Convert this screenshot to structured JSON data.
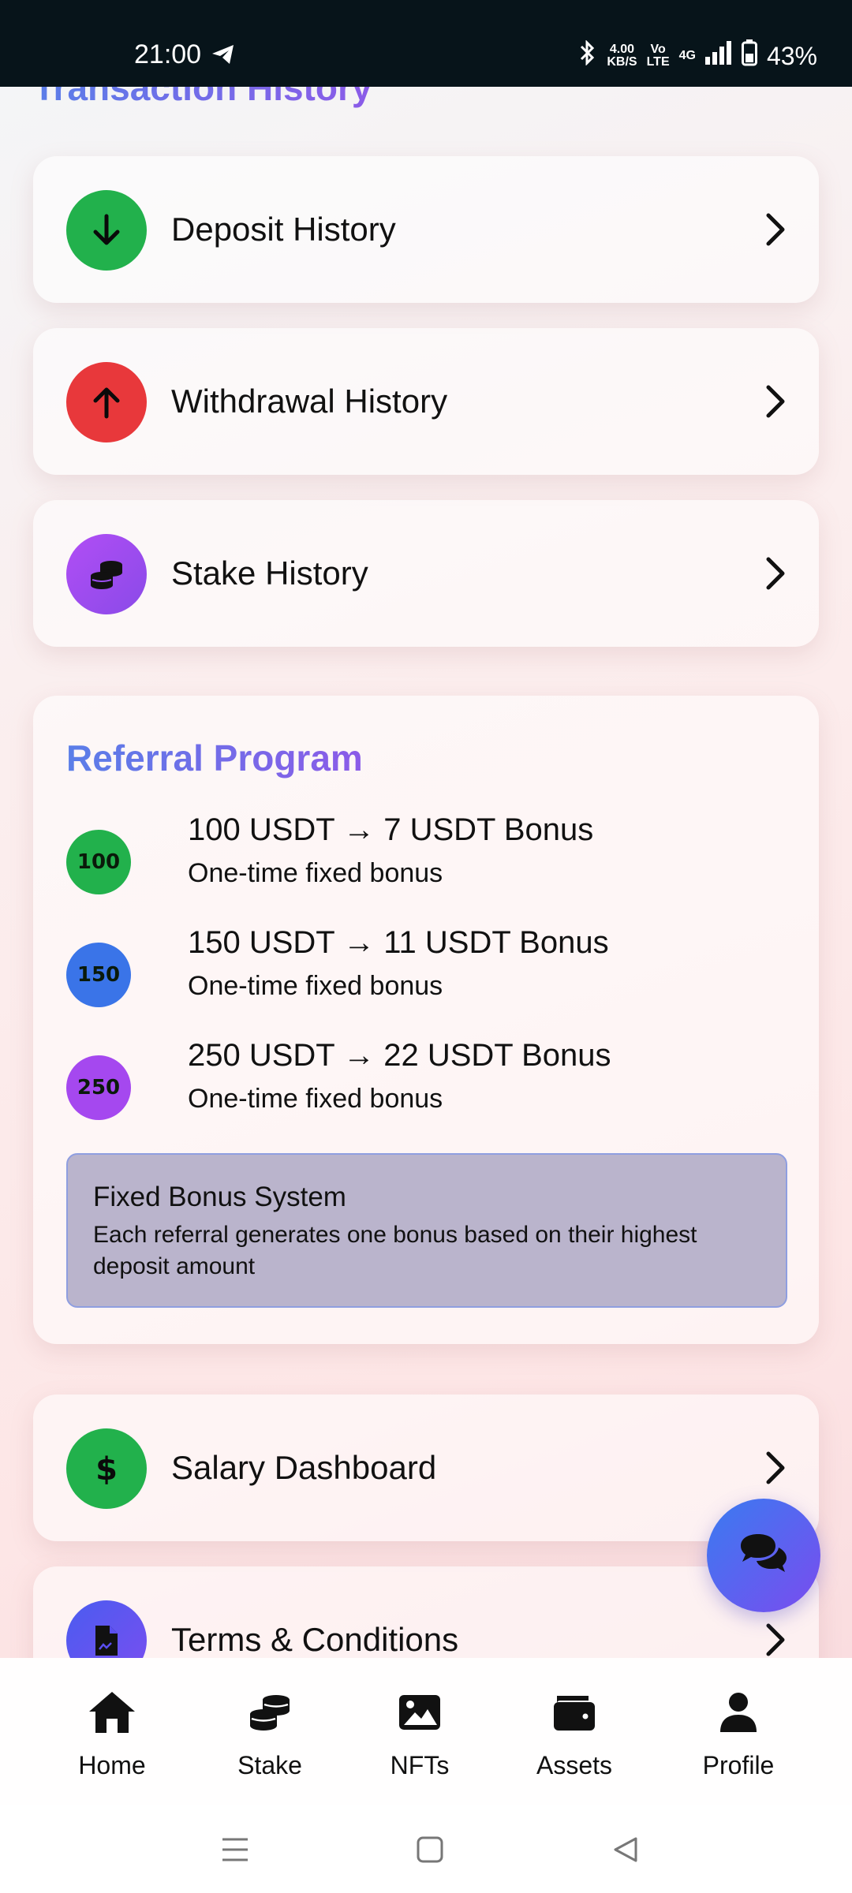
{
  "status_bar": {
    "time": "21:00",
    "net_speed_value": "4.00",
    "net_speed_unit": "KB/S",
    "volte": "Vo",
    "volte_sub": "LTE",
    "network": "4G",
    "battery": "43%"
  },
  "transaction": {
    "title": "Transaction History",
    "items": [
      {
        "label": "Deposit History",
        "icon": "arrow-down-icon",
        "color": "#22b14c"
      },
      {
        "label": "Withdrawal History",
        "icon": "arrow-up-icon",
        "color": "#e8383b"
      },
      {
        "label": "Stake History",
        "icon": "coins-icon",
        "color": "#9a4ef0"
      }
    ]
  },
  "referral": {
    "title": "Referral Program",
    "tiers": [
      {
        "badge": "100",
        "main": "100 USDT → 7 USDT Bonus",
        "sub": "One-time fixed bonus",
        "color": "#22b14c"
      },
      {
        "badge": "150",
        "main": "150 USDT → 11 USDT Bonus",
        "sub": "One-time fixed bonus",
        "color": "#3a74e8"
      },
      {
        "badge": "250",
        "main": "250 USDT → 22 USDT Bonus",
        "sub": "One-time fixed bonus",
        "color": "#a548ef"
      }
    ],
    "info_title": "Fixed Bonus System",
    "info_text": "Each referral generates one bonus based on their highest deposit amount"
  },
  "more": {
    "items": [
      {
        "label": "Salary Dashboard",
        "icon": "dollar-icon",
        "color": "#22b14c"
      },
      {
        "label": "Terms & Conditions",
        "icon": "document-icon",
        "color": "#5a4ef0"
      }
    ]
  },
  "bottom_nav": {
    "items": [
      {
        "label": "Home",
        "icon": "home-icon"
      },
      {
        "label": "Stake",
        "icon": "coins-icon"
      },
      {
        "label": "NFTs",
        "icon": "image-icon"
      },
      {
        "label": "Assets",
        "icon": "wallet-icon"
      },
      {
        "label": "Profile",
        "icon": "user-icon"
      }
    ]
  },
  "colors": {
    "accent_start": "#5a7ee8",
    "accent_end": "#8b5be8",
    "fab_start": "#3a7bf0",
    "fab_end": "#7a4cef"
  }
}
